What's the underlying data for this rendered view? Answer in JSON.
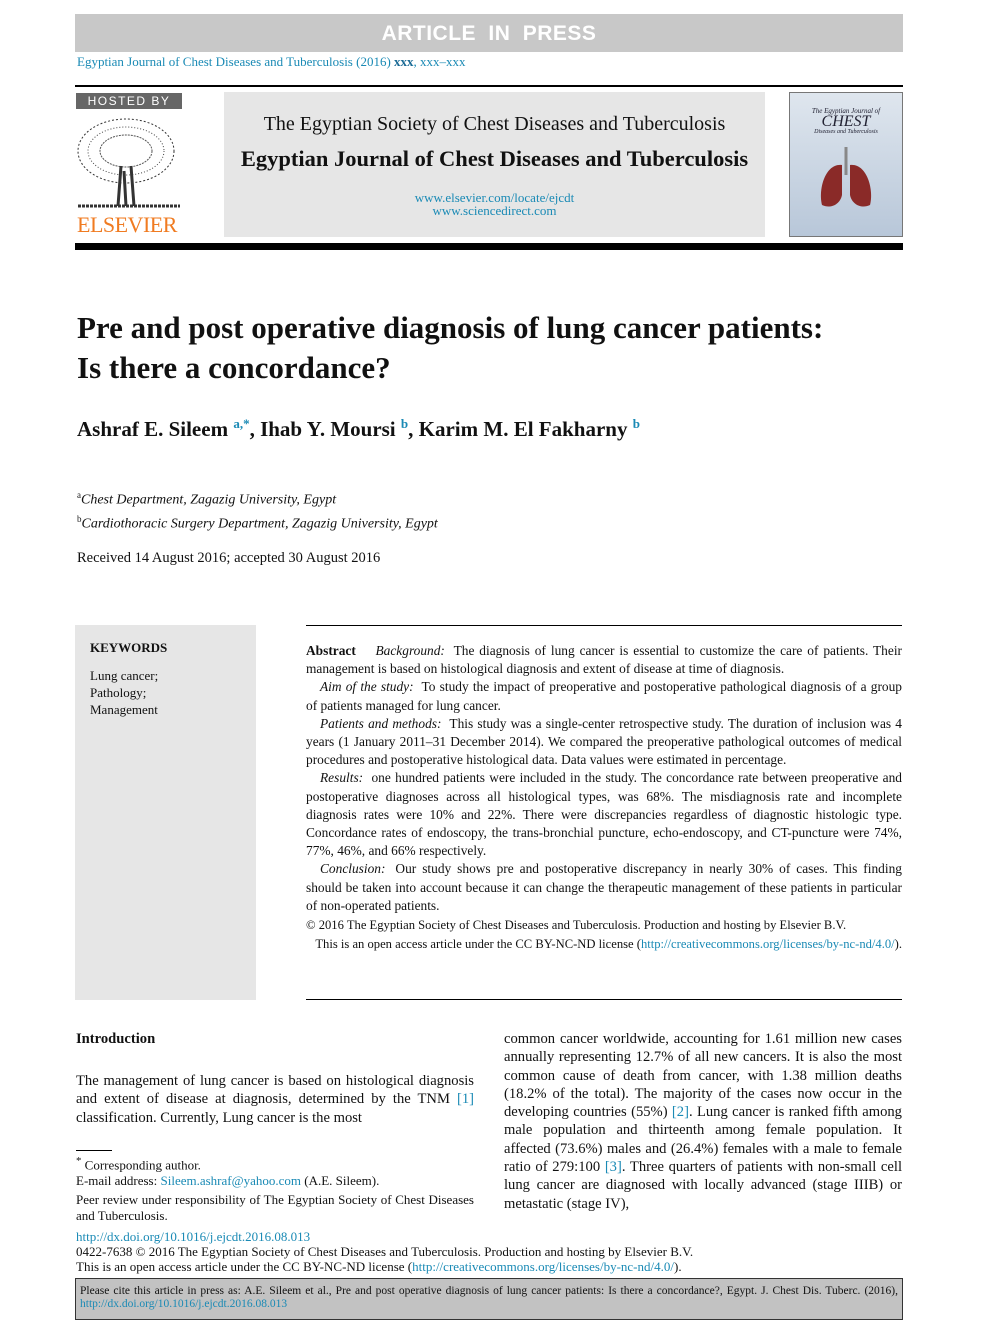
{
  "banner": {
    "article_in_press": "ARTICLE IN PRESS"
  },
  "journal_ref": {
    "text": "Egyptian Journal of Chest Diseases and Tuberculosis (2016) ",
    "volume": "xxx",
    "pages": ", xxx–xxx"
  },
  "header": {
    "hosted_by": "HOSTED BY",
    "publisher": "ELSEVIER",
    "society": "The Egyptian Society of Chest Diseases and Tuberculosis",
    "journal": "Egyptian Journal of Chest Diseases and Tuberculosis",
    "url1": "www.elsevier.com/locate/ejcdt",
    "url2": "www.sciencedirect.com",
    "cover_title_top": "The Egyptian Journal of",
    "cover_title": "CHEST",
    "cover_title_bottom": "Diseases and Tuberculosis"
  },
  "article": {
    "title": "Pre and post operative diagnosis of lung cancer patients: Is there a concordance?",
    "authors": [
      {
        "name": "Ashraf E. Sileem",
        "sup": "a,*"
      },
      {
        "name": "Ihab Y. Moursi",
        "sup": "b"
      },
      {
        "name": "Karim M. El Fakharny",
        "sup": "b"
      }
    ],
    "affiliations": [
      {
        "sup": "a",
        "text": "Chest Department, Zagazig University, Egypt"
      },
      {
        "sup": "b",
        "text": "Cardiothoracic Surgery Department, Zagazig University, Egypt"
      }
    ],
    "dates": "Received 14 August 2016; accepted 30 August 2016"
  },
  "keywords": {
    "heading": "KEYWORDS",
    "items": [
      "Lung cancer;",
      "Pathology;",
      "Management"
    ]
  },
  "abstract": {
    "label": "Abstract",
    "sections": [
      {
        "head": "Background:",
        "text": "The diagnosis of lung cancer is essential to customize the care of patients. Their management is based on histological diagnosis and extent of disease at time of diagnosis."
      },
      {
        "head": "Aim of the study:",
        "text": "To study the impact of preoperative and postoperative pathological diagnosis of a group of patients managed for lung cancer."
      },
      {
        "head": "Patients and methods:",
        "text": "This study was a single-center retrospective study. The duration of inclusion was 4 years (1 January 2011–31 December 2014). We compared the preoperative pathological outcomes of medical procedures and postoperative histological data. Data values were estimated in percentage."
      },
      {
        "head": "Results:",
        "text": "one hundred patients were included in the study. The concordance rate between preoperative and postoperative diagnoses across all histological types, was 68%. The misdiagnosis rate and incomplete diagnosis rates were 10% and 22%. There were discrepancies regardless of diagnostic histologic type. Concordance rates of endoscopy, the trans-bronchial puncture, echo-endoscopy, and CT-puncture were 74%, 77%, 46%, and 66% respectively."
      },
      {
        "head": "Conclusion:",
        "text": "Our study shows pre and postoperative discrepancy in nearly 30% of cases. This finding should be taken into account because it can change the therapeutic management of these patients in particular of non-operated patients."
      }
    ],
    "copyright": "© 2016 The Egyptian Society of Chest Diseases and Tuberculosis. Production and hosting by Elsevier B.V.",
    "license_pre": "This is an open access article under the CC BY-NC-ND license (",
    "license_url": "http://creativecommons.org/licenses/by-nc-nd/4.0/",
    "license_post": ")."
  },
  "intro": {
    "heading": "Introduction",
    "p1_a": "The management of lung cancer is based on histological diagnosis and extent of disease at diagnosis, determined by the TNM ",
    "ref1": "[1]",
    "p1_b": " classification. Currently, Lung cancer is the most",
    "p2_a": "common cancer worldwide, accounting for 1.61 million new cases annually representing 12.7% of all new cancers. It is also the most common cause of death from cancer, with 1.38 million deaths (18.2% of the total). The majority of the cases now occur in the developing countries (55%) ",
    "ref2": "[2]",
    "p2_b": ". Lung cancer is ranked fifth among male population and thirteenth among female population. It affected (73.6%) males and (26.4%) females with a male to female ratio of 279:100 ",
    "ref3": "[3]",
    "p2_c": ". Three quarters of patients with non-small cell lung cancer are diagnosed with locally advanced (stage IIIB) or metastatic (stage IV),"
  },
  "footnotes": {
    "star": "*",
    "corresponding": "Corresponding author.",
    "email_label": "E-mail address: ",
    "email": "Sileem.ashraf@yahoo.com",
    "email_name": " (A.E. Sileem).",
    "peer_review": "Peer review under responsibility of The Egyptian Society of Chest Diseases and Tuberculosis."
  },
  "footer": {
    "doi": "http://dx.doi.org/10.1016/j.ejcdt.2016.08.013",
    "issn": "0422-7638 © 2016 The Egyptian Society of Chest Diseases and Tuberculosis. Production and hosting by Elsevier B.V.",
    "license_pre": "This is an open access article under the CC BY-NC-ND license (",
    "license_url": "http://creativecommons.org/licenses/by-nc-nd/4.0/",
    "license_post": ")."
  },
  "cite": {
    "text": "Please cite this article in press as: A.E. Sileem et al., Pre and post operative diagnosis of lung cancer patients: Is there a concordance?,  Egypt. J. Chest Dis. Tuberc. (2016), ",
    "doi": "http://dx.doi.org/10.1016/j.ejcdt.2016.08.013"
  },
  "colors": {
    "link": "#1a8ab5",
    "elsevier_orange": "#f07b21",
    "banner_gray": "#c8c8c8"
  }
}
